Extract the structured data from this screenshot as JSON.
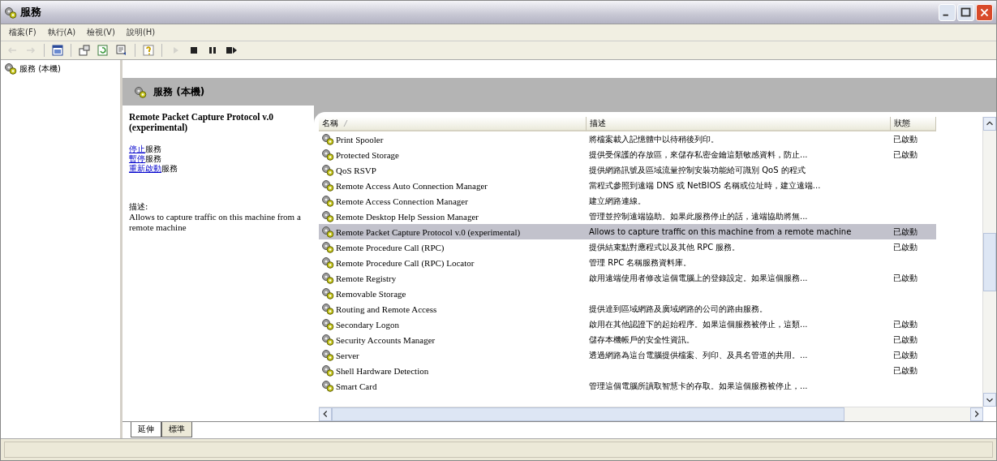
{
  "window": {
    "title": "服務"
  },
  "menu": [
    "檔案(F)",
    "執行(A)",
    "檢視(V)",
    "說明(H)"
  ],
  "toolbar": [
    {
      "kind": "back",
      "disabled": true
    },
    {
      "kind": "forward",
      "disabled": true
    },
    {
      "kind": "console",
      "disabled": false
    },
    {
      "kind": "properties",
      "disabled": false
    },
    {
      "kind": "refresh",
      "disabled": false
    },
    {
      "kind": "export",
      "disabled": false
    },
    {
      "kind": "help",
      "disabled": false
    },
    {
      "kind": "play",
      "disabled": true
    },
    {
      "kind": "stop",
      "disabled": false
    },
    {
      "kind": "pause",
      "disabled": false
    },
    {
      "kind": "restart",
      "disabled": false
    }
  ],
  "tree": {
    "items": [
      {
        "label": "服務 (本機)",
        "selected": false
      }
    ]
  },
  "header": {
    "title": "服務 (本機)"
  },
  "details": {
    "service_name": "Remote Packet Capture Protocol v.0 (experimental)",
    "actions": [
      {
        "link": "停止",
        "text": "服務"
      },
      {
        "link": "暫停",
        "text": "服務"
      },
      {
        "link": "重新啟動",
        "text": "服務"
      }
    ],
    "description_label": "描述:",
    "description": "Allows to capture traffic on this machine from a remote machine"
  },
  "table": {
    "columns": [
      "名稱",
      "描述",
      "狀態"
    ],
    "rows": [
      {
        "name": "Print Spooler",
        "description": "將檔案載入記憶體中以待稍後列印。",
        "status": "已啟動",
        "selected": false
      },
      {
        "name": "Protected Storage",
        "description": "提供受保護的存放區，來儲存私密金鑰這類敏感資料，防止...",
        "status": "已啟動",
        "selected": false
      },
      {
        "name": "QoS RSVP",
        "description": "提供網路訊號及區域流量控制安裝功能給可識別 QoS 的程式",
        "status": "",
        "selected": false
      },
      {
        "name": "Remote Access Auto Connection Manager",
        "description": "當程式參照到遠端 DNS 或 NetBIOS 名稱或位址時，建立遠端...",
        "status": "",
        "selected": false
      },
      {
        "name": "Remote Access Connection Manager",
        "description": "建立網路連線。",
        "status": "",
        "selected": false
      },
      {
        "name": "Remote Desktop Help Session Manager",
        "description": "管理並控制遠端協助。如果此服務停止的話，遠端協助將無...",
        "status": "",
        "selected": false
      },
      {
        "name": "Remote Packet Capture Protocol v.0 (experimental)",
        "description": "Allows to capture traffic on this machine from a remote machine",
        "status": "已啟動",
        "selected": true
      },
      {
        "name": "Remote Procedure Call (RPC)",
        "description": "提供結束點對應程式以及其他 RPC 服務。",
        "status": "已啟動",
        "selected": false
      },
      {
        "name": "Remote Procedure Call (RPC) Locator",
        "description": "管理 RPC 名稱服務資料庫。",
        "status": "",
        "selected": false
      },
      {
        "name": "Remote Registry",
        "description": "啟用遠端使用者修改這個電腦上的登錄設定。如果這個服務...",
        "status": "已啟動",
        "selected": false
      },
      {
        "name": "Removable Storage",
        "description": "",
        "status": "",
        "selected": false
      },
      {
        "name": "Routing and Remote Access",
        "description": "提供達到區域網路及廣域網路的公司的路由服務。",
        "status": "",
        "selected": false
      },
      {
        "name": "Secondary Logon",
        "description": "啟用在其他認證下的起始程序。如果這個服務被停止，這類...",
        "status": "已啟動",
        "selected": false
      },
      {
        "name": "Security Accounts Manager",
        "description": "儲存本機帳戶的安全性資訊。",
        "status": "已啟動",
        "selected": false
      },
      {
        "name": "Server",
        "description": "透過網路為這台電腦提供檔案、列印、及具名管道的共用。...",
        "status": "已啟動",
        "selected": false
      },
      {
        "name": "Shell Hardware Detection",
        "description": "",
        "status": "已啟動",
        "selected": false
      },
      {
        "name": "Smart Card",
        "description": "管理這個電腦所讀取智慧卡的存取。如果這個服務被停止，...",
        "status": "",
        "selected": false
      }
    ]
  },
  "view_tabs": [
    {
      "label": "延伸",
      "selected": true
    },
    {
      "label": "標準",
      "selected": false
    }
  ]
}
